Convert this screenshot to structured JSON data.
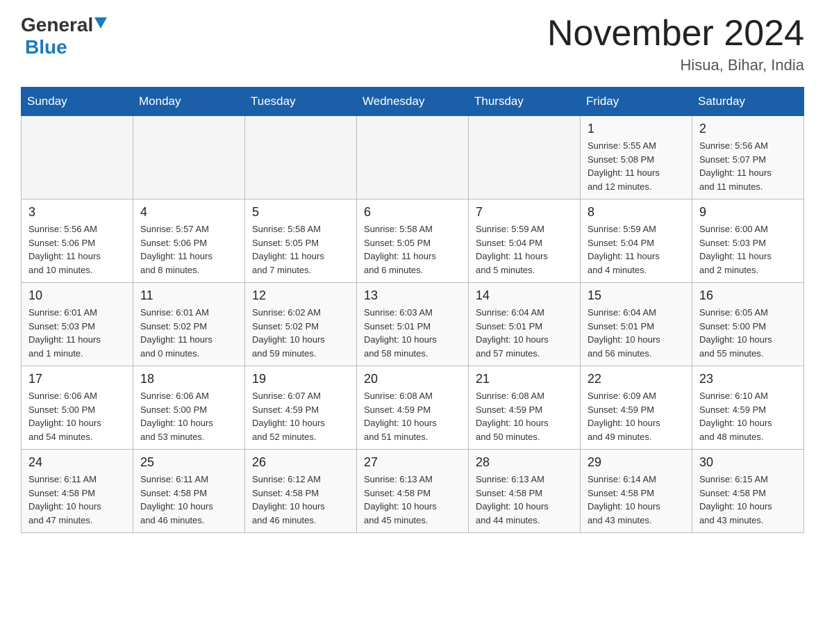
{
  "header": {
    "logo_general": "General",
    "logo_blue": "Blue",
    "title": "November 2024",
    "subtitle": "Hisua, Bihar, India"
  },
  "weekdays": [
    "Sunday",
    "Monday",
    "Tuesday",
    "Wednesday",
    "Thursday",
    "Friday",
    "Saturday"
  ],
  "weeks": [
    [
      {
        "day": "",
        "info": ""
      },
      {
        "day": "",
        "info": ""
      },
      {
        "day": "",
        "info": ""
      },
      {
        "day": "",
        "info": ""
      },
      {
        "day": "",
        "info": ""
      },
      {
        "day": "1",
        "info": "Sunrise: 5:55 AM\nSunset: 5:08 PM\nDaylight: 11 hours\nand 12 minutes."
      },
      {
        "day": "2",
        "info": "Sunrise: 5:56 AM\nSunset: 5:07 PM\nDaylight: 11 hours\nand 11 minutes."
      }
    ],
    [
      {
        "day": "3",
        "info": "Sunrise: 5:56 AM\nSunset: 5:06 PM\nDaylight: 11 hours\nand 10 minutes."
      },
      {
        "day": "4",
        "info": "Sunrise: 5:57 AM\nSunset: 5:06 PM\nDaylight: 11 hours\nand 8 minutes."
      },
      {
        "day": "5",
        "info": "Sunrise: 5:58 AM\nSunset: 5:05 PM\nDaylight: 11 hours\nand 7 minutes."
      },
      {
        "day": "6",
        "info": "Sunrise: 5:58 AM\nSunset: 5:05 PM\nDaylight: 11 hours\nand 6 minutes."
      },
      {
        "day": "7",
        "info": "Sunrise: 5:59 AM\nSunset: 5:04 PM\nDaylight: 11 hours\nand 5 minutes."
      },
      {
        "day": "8",
        "info": "Sunrise: 5:59 AM\nSunset: 5:04 PM\nDaylight: 11 hours\nand 4 minutes."
      },
      {
        "day": "9",
        "info": "Sunrise: 6:00 AM\nSunset: 5:03 PM\nDaylight: 11 hours\nand 2 minutes."
      }
    ],
    [
      {
        "day": "10",
        "info": "Sunrise: 6:01 AM\nSunset: 5:03 PM\nDaylight: 11 hours\nand 1 minute."
      },
      {
        "day": "11",
        "info": "Sunrise: 6:01 AM\nSunset: 5:02 PM\nDaylight: 11 hours\nand 0 minutes."
      },
      {
        "day": "12",
        "info": "Sunrise: 6:02 AM\nSunset: 5:02 PM\nDaylight: 10 hours\nand 59 minutes."
      },
      {
        "day": "13",
        "info": "Sunrise: 6:03 AM\nSunset: 5:01 PM\nDaylight: 10 hours\nand 58 minutes."
      },
      {
        "day": "14",
        "info": "Sunrise: 6:04 AM\nSunset: 5:01 PM\nDaylight: 10 hours\nand 57 minutes."
      },
      {
        "day": "15",
        "info": "Sunrise: 6:04 AM\nSunset: 5:01 PM\nDaylight: 10 hours\nand 56 minutes."
      },
      {
        "day": "16",
        "info": "Sunrise: 6:05 AM\nSunset: 5:00 PM\nDaylight: 10 hours\nand 55 minutes."
      }
    ],
    [
      {
        "day": "17",
        "info": "Sunrise: 6:06 AM\nSunset: 5:00 PM\nDaylight: 10 hours\nand 54 minutes."
      },
      {
        "day": "18",
        "info": "Sunrise: 6:06 AM\nSunset: 5:00 PM\nDaylight: 10 hours\nand 53 minutes."
      },
      {
        "day": "19",
        "info": "Sunrise: 6:07 AM\nSunset: 4:59 PM\nDaylight: 10 hours\nand 52 minutes."
      },
      {
        "day": "20",
        "info": "Sunrise: 6:08 AM\nSunset: 4:59 PM\nDaylight: 10 hours\nand 51 minutes."
      },
      {
        "day": "21",
        "info": "Sunrise: 6:08 AM\nSunset: 4:59 PM\nDaylight: 10 hours\nand 50 minutes."
      },
      {
        "day": "22",
        "info": "Sunrise: 6:09 AM\nSunset: 4:59 PM\nDaylight: 10 hours\nand 49 minutes."
      },
      {
        "day": "23",
        "info": "Sunrise: 6:10 AM\nSunset: 4:59 PM\nDaylight: 10 hours\nand 48 minutes."
      }
    ],
    [
      {
        "day": "24",
        "info": "Sunrise: 6:11 AM\nSunset: 4:58 PM\nDaylight: 10 hours\nand 47 minutes."
      },
      {
        "day": "25",
        "info": "Sunrise: 6:11 AM\nSunset: 4:58 PM\nDaylight: 10 hours\nand 46 minutes."
      },
      {
        "day": "26",
        "info": "Sunrise: 6:12 AM\nSunset: 4:58 PM\nDaylight: 10 hours\nand 46 minutes."
      },
      {
        "day": "27",
        "info": "Sunrise: 6:13 AM\nSunset: 4:58 PM\nDaylight: 10 hours\nand 45 minutes."
      },
      {
        "day": "28",
        "info": "Sunrise: 6:13 AM\nSunset: 4:58 PM\nDaylight: 10 hours\nand 44 minutes."
      },
      {
        "day": "29",
        "info": "Sunrise: 6:14 AM\nSunset: 4:58 PM\nDaylight: 10 hours\nand 43 minutes."
      },
      {
        "day": "30",
        "info": "Sunrise: 6:15 AM\nSunset: 4:58 PM\nDaylight: 10 hours\nand 43 minutes."
      }
    ]
  ]
}
